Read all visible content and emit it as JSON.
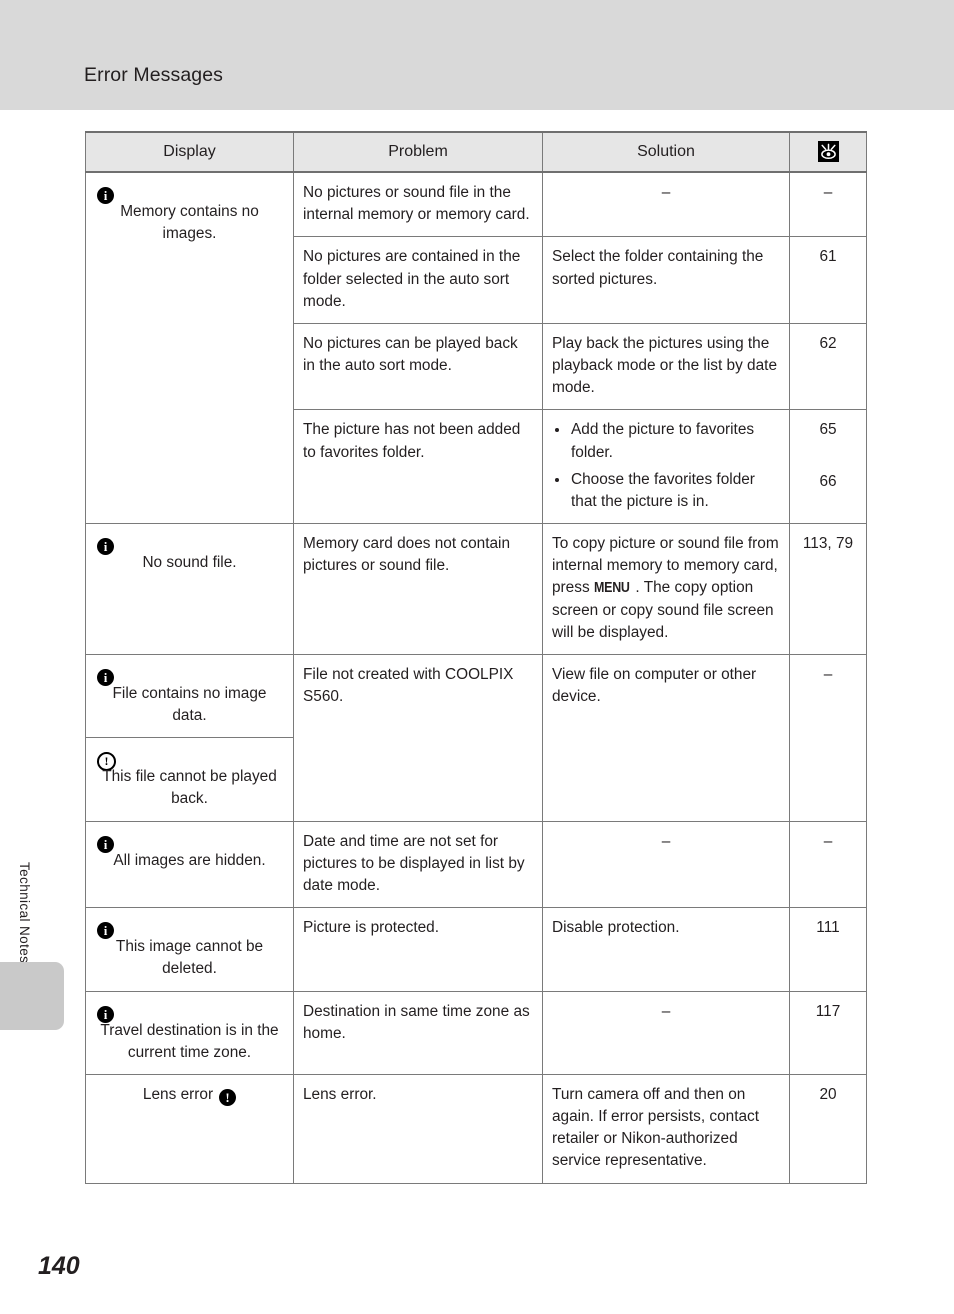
{
  "header": {
    "title": "Error Messages"
  },
  "sidebar": {
    "section_label": "Technical Notes"
  },
  "footer": {
    "page_number": "140"
  },
  "table": {
    "columns": [
      {
        "label": "Display"
      },
      {
        "label": "Problem"
      },
      {
        "label": "Solution"
      },
      {
        "label": "",
        "icon": "reference-page-icon"
      }
    ],
    "rows": [
      {
        "display": {
          "icon": "info-icon-solid",
          "message": "Memory contains no images."
        },
        "entries": [
          {
            "problem": "No pictures or sound file in the internal memory or memory card.",
            "solution": "–",
            "page": "–"
          },
          {
            "problem": "No pictures are contained in the folder selected in the auto sort mode.",
            "solution": "Select the folder containing the sorted pictures.",
            "page": "61"
          },
          {
            "problem": "No pictures can be played back in the auto sort mode.",
            "solution": "Play back the pictures using the playback mode or the list by date mode.",
            "page": "62"
          },
          {
            "problem": "The picture has not been added to favorites folder.",
            "solution_bullets": [
              "Add the picture to favorites folder.",
              "Choose the favorites folder that the picture is in."
            ],
            "pages": [
              "65",
              "66"
            ]
          }
        ]
      },
      {
        "display": {
          "icon": "info-icon-solid",
          "message": "No sound file."
        },
        "entries": [
          {
            "problem": "Memory card does not contain pictures or sound file.",
            "solution_parts": [
              "To copy picture or sound file from internal memory to memory card, press ",
              "MENU",
              ". The copy option screen or copy sound file screen will be displayed."
            ],
            "page": "113, 79"
          }
        ]
      },
      {
        "display_group": [
          {
            "icon": "info-icon-solid",
            "message": "File contains no image data."
          },
          {
            "icon": "warning-icon-outline",
            "message": "This file cannot be played back."
          }
        ],
        "entries": [
          {
            "problem": "File not created with COOLPIX S560.",
            "solution": "View file on computer or other device.",
            "page": "–"
          }
        ]
      },
      {
        "display": {
          "icon": "info-icon-solid",
          "message": "All images are hidden."
        },
        "entries": [
          {
            "problem": "Date and time are not set for pictures to be displayed in list by date mode.",
            "solution": "–",
            "page": "–"
          }
        ]
      },
      {
        "display": {
          "icon": "info-icon-solid",
          "message": "This image cannot be deleted."
        },
        "entries": [
          {
            "problem": "Picture is protected.",
            "solution": "Disable protection.",
            "page": "111"
          }
        ]
      },
      {
        "display": {
          "icon": "info-icon-solid",
          "message": "Travel destination is in the current time zone."
        },
        "entries": [
          {
            "problem": "Destination in same time zone as home.",
            "solution": "–",
            "page": "117"
          }
        ]
      },
      {
        "display": {
          "message": "Lens error",
          "icon_after": "warning-icon-solid"
        },
        "entries": [
          {
            "problem": "Lens error.",
            "solution": "Turn camera off and then on again. If error persists, contact retailer or Nikon-authorized service representative.",
            "page": "20"
          }
        ]
      }
    ]
  }
}
